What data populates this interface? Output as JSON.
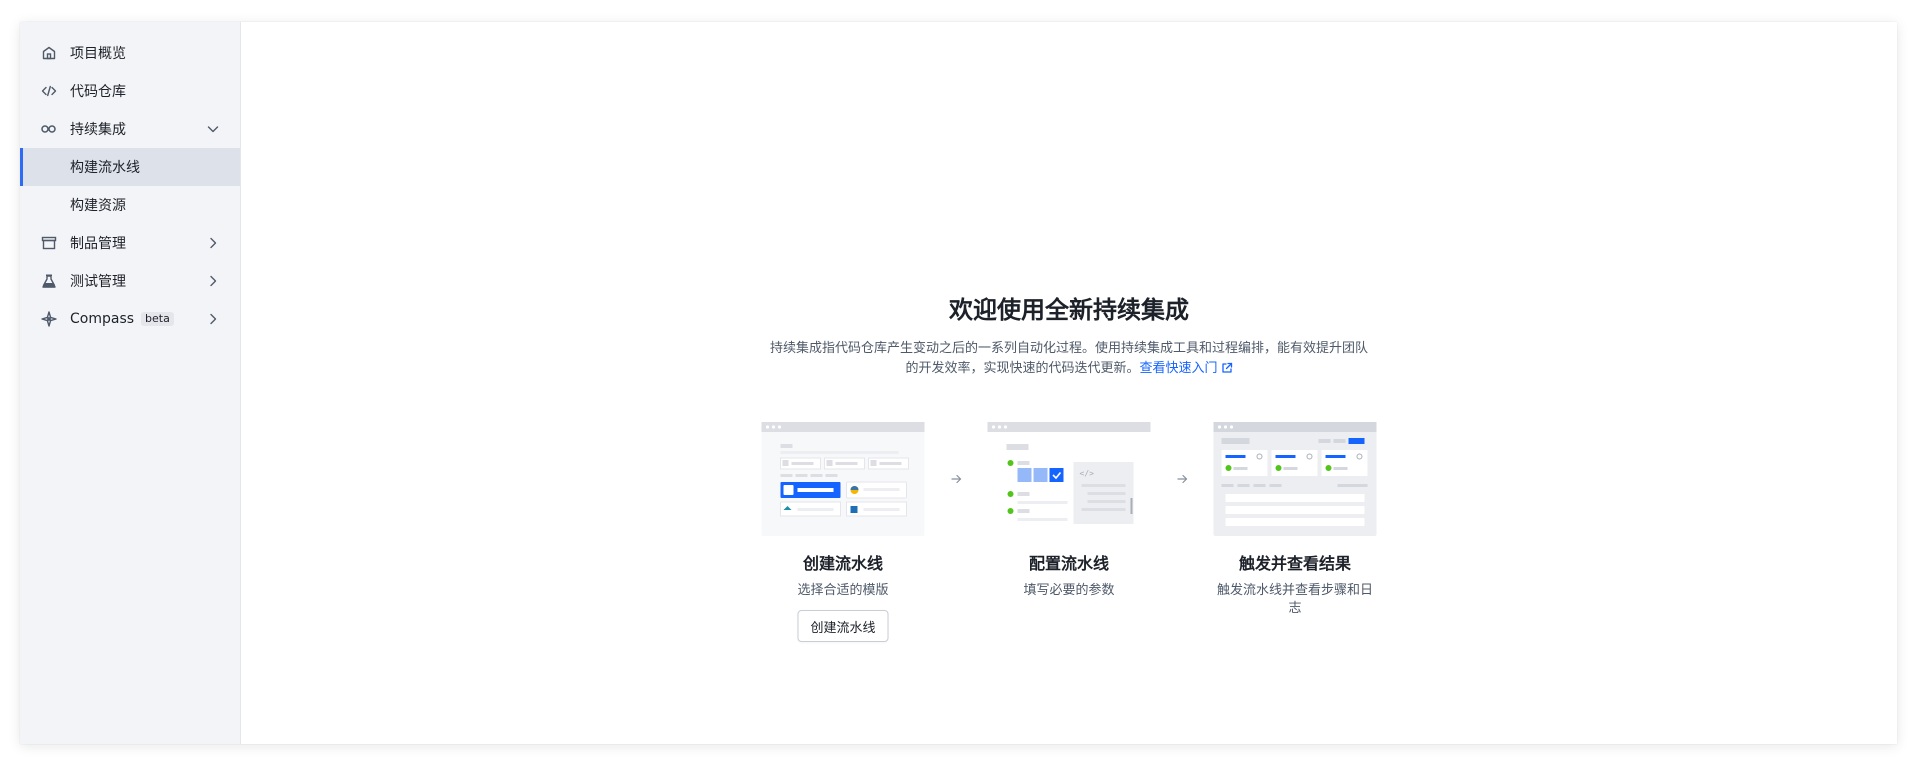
{
  "sidebar": {
    "items": [
      {
        "label": "项目概览"
      },
      {
        "label": "代码仓库"
      },
      {
        "label": "持续集成"
      },
      {
        "label": "构建流水线"
      },
      {
        "label": "构建资源"
      },
      {
        "label": "制品管理"
      },
      {
        "label": "测试管理"
      },
      {
        "label": "Compass",
        "badge": "beta"
      }
    ]
  },
  "main": {
    "title": "欢迎使用全新持续集成",
    "description_line1": "持续集成指代码仓库产生变动之后的一系列自动化过程。使用持续集成工具和过程编排，能有效提升团队",
    "description_line2": "的开发效率，实现快速的代码迭代更新。",
    "quickstart_link": "查看快速入门",
    "steps": [
      {
        "title": "创建流水线",
        "subtitle": "选择合适的模版",
        "button": "创建流水线"
      },
      {
        "title": "配置流水线",
        "subtitle": "填写必要的参数"
      },
      {
        "title": "触发并查看结果",
        "subtitle": "触发流水线并查看步骤和日志"
      }
    ]
  },
  "colors": {
    "accent": "#2d6bf5",
    "link": "#1664ff",
    "sidebar_bg": "#f3f4f7",
    "active_bg": "#dde1e9"
  }
}
